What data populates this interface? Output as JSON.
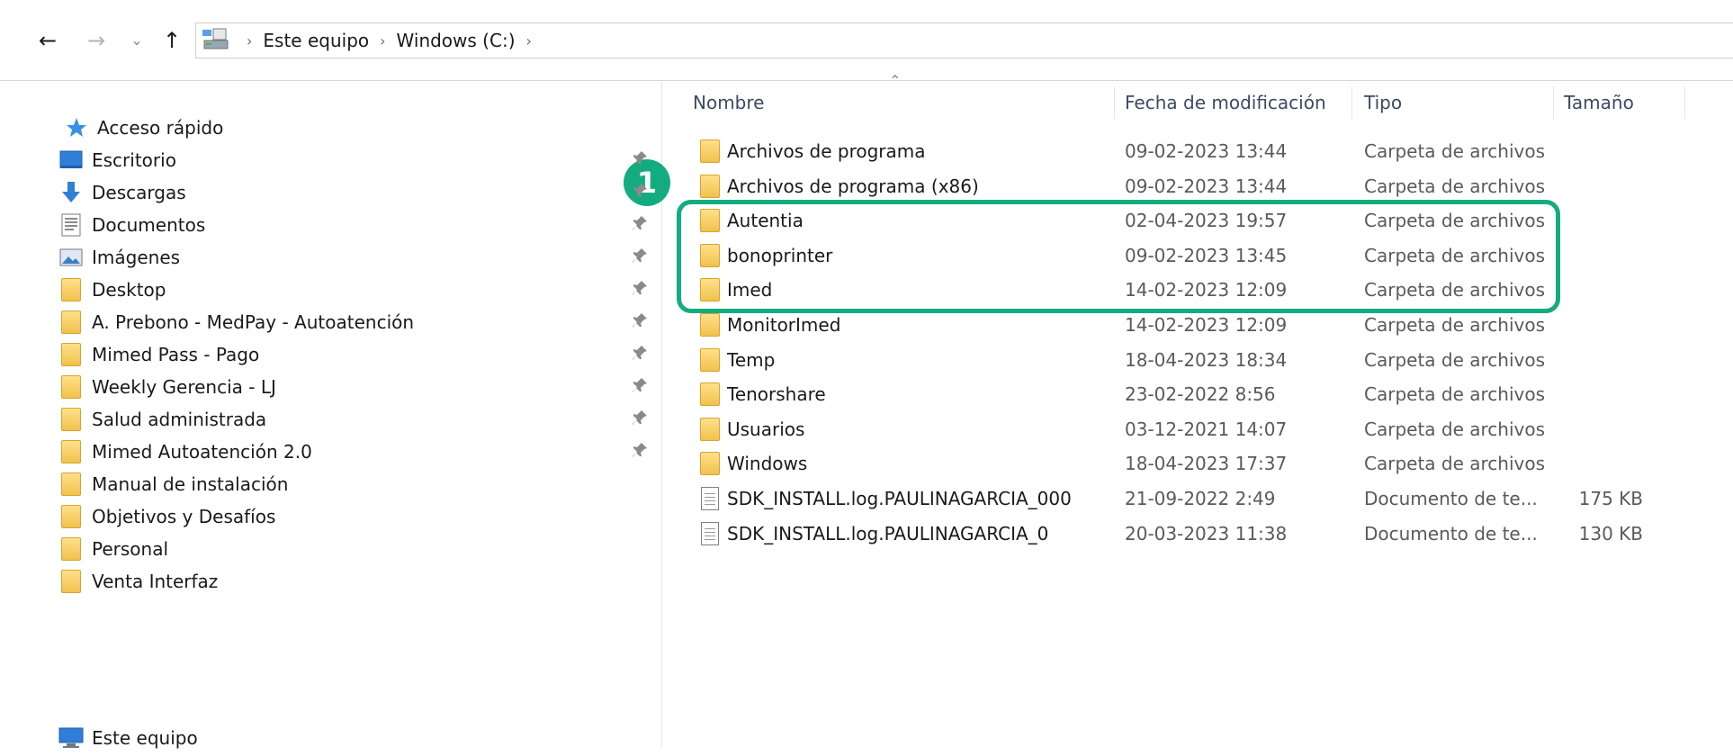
{
  "address": {
    "crumbs": [
      "Este equipo",
      "Windows (C:)"
    ]
  },
  "sidebar": {
    "quick_access": "Acceso rápido",
    "items": [
      {
        "label": "Escritorio",
        "icon": "desktop-icon",
        "pinned": true
      },
      {
        "label": "Descargas",
        "icon": "download-icon",
        "pinned": true
      },
      {
        "label": "Documentos",
        "icon": "documents-icon",
        "pinned": true
      },
      {
        "label": "Imágenes",
        "icon": "pictures-icon",
        "pinned": true
      },
      {
        "label": "Desktop",
        "icon": "folder-icon",
        "pinned": true
      },
      {
        "label": "A. Prebono - MedPay - Autoatención",
        "icon": "folder-icon",
        "pinned": true
      },
      {
        "label": "Mimed Pass - Pago",
        "icon": "folder-icon",
        "pinned": true
      },
      {
        "label": "Weekly Gerencia - LJ",
        "icon": "folder-icon",
        "pinned": true
      },
      {
        "label": "Salud administrada",
        "icon": "folder-icon",
        "pinned": true
      },
      {
        "label": "Mimed Autoatención 2.0",
        "icon": "folder-icon",
        "pinned": true
      },
      {
        "label": "Manual de instalación",
        "icon": "folder-icon",
        "pinned": false
      },
      {
        "label": "Objetivos y Desafíos",
        "icon": "folder-icon",
        "pinned": false
      },
      {
        "label": "Personal",
        "icon": "folder-icon",
        "pinned": false
      },
      {
        "label": "Venta Interfaz",
        "icon": "folder-icon",
        "pinned": false
      }
    ],
    "this_pc": "Este equipo"
  },
  "columns": {
    "name": "Nombre",
    "date": "Fecha de modificación",
    "type": "Tipo",
    "size": "Tamaño"
  },
  "files": [
    {
      "name": "Archivos de programa",
      "date": "09-02-2023 13:44",
      "type": "Carpeta de archivos",
      "size": "",
      "kind": "folder"
    },
    {
      "name": "Archivos de programa (x86)",
      "date": "09-02-2023 13:44",
      "type": "Carpeta de archivos",
      "size": "",
      "kind": "folder"
    },
    {
      "name": "Autentia",
      "date": "02-04-2023 19:57",
      "type": "Carpeta de archivos",
      "size": "",
      "kind": "folder"
    },
    {
      "name": "bonoprinter",
      "date": "09-02-2023 13:45",
      "type": "Carpeta de archivos",
      "size": "",
      "kind": "folder"
    },
    {
      "name": "Imed",
      "date": "14-02-2023 12:09",
      "type": "Carpeta de archivos",
      "size": "",
      "kind": "folder"
    },
    {
      "name": "MonitorImed",
      "date": "14-02-2023 12:09",
      "type": "Carpeta de archivos",
      "size": "",
      "kind": "folder"
    },
    {
      "name": "Temp",
      "date": "18-04-2023 18:34",
      "type": "Carpeta de archivos",
      "size": "",
      "kind": "folder"
    },
    {
      "name": "Tenorshare",
      "date": "23-02-2022 8:56",
      "type": "Carpeta de archivos",
      "size": "",
      "kind": "folder"
    },
    {
      "name": "Usuarios",
      "date": "03-12-2021 14:07",
      "type": "Carpeta de archivos",
      "size": "",
      "kind": "folder"
    },
    {
      "name": "Windows",
      "date": "18-04-2023 17:37",
      "type": "Carpeta de archivos",
      "size": "",
      "kind": "folder"
    },
    {
      "name": "SDK_INSTALL.log.PAULINAGARCIA_000",
      "date": "21-09-2022 2:49",
      "type": "Documento de te...",
      "size": "175 KB",
      "kind": "file"
    },
    {
      "name": "SDK_INSTALL.log.PAULINAGARCIA_0",
      "date": "20-03-2023 11:38",
      "type": "Documento de te...",
      "size": "130 KB",
      "kind": "file"
    }
  ],
  "annotation": {
    "badge": "1",
    "color": "#13ac80"
  }
}
